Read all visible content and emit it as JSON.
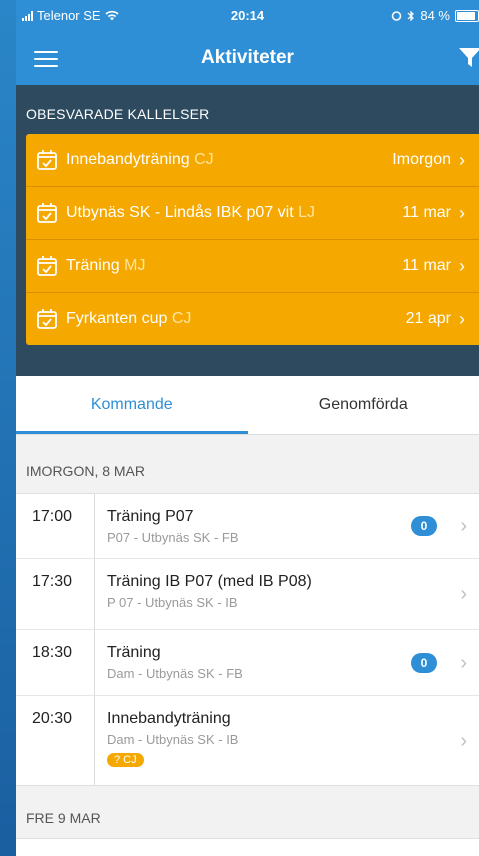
{
  "status": {
    "carrier": "Telenor SE",
    "time": "20:14",
    "battery": "84 %"
  },
  "nav": {
    "title": "Aktiviteter"
  },
  "pending": {
    "heading": "OBESVARADE KALLELSER",
    "items": [
      {
        "name": "Innebandyträning",
        "initials": "CJ",
        "date": "Imorgon"
      },
      {
        "name": "Utbynäs SK - Lindås IBK p07 vit",
        "initials": "LJ",
        "date": "11 mar"
      },
      {
        "name": "Träning",
        "initials": "MJ",
        "date": "11 mar"
      },
      {
        "name": "Fyrkanten cup",
        "initials": "CJ",
        "date": "21 apr"
      }
    ]
  },
  "tabs": [
    {
      "label": "Kommande"
    },
    {
      "label": "Genomförda"
    }
  ],
  "sections": [
    {
      "heading": "IMORGON, 8 MAR",
      "events": [
        {
          "time": "17:00",
          "title": "Träning P07",
          "sub": "P07 - Utbynäs SK - FB",
          "badge": "0"
        },
        {
          "time": "17:30",
          "title": "Träning IB P07 (med IB P08)",
          "sub": "P 07 - Utbynäs SK - IB"
        },
        {
          "time": "18:30",
          "title": "Träning",
          "sub": "Dam - Utbynäs SK - FB",
          "badge": "0"
        },
        {
          "time": "20:30",
          "title": "Innebandyträning",
          "sub": "Dam - Utbynäs SK - IB",
          "tag": "? CJ"
        }
      ]
    },
    {
      "heading": "FRE 9 MAR"
    }
  ],
  "colors": {
    "primary": "#2e8fd6",
    "pending_bg": "#2d4a5e",
    "accent": "#f5a800"
  }
}
